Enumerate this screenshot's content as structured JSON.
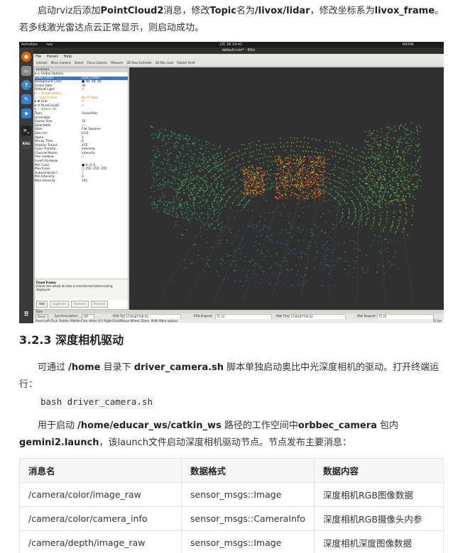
{
  "intro": {
    "t1": "启动rviz后添加",
    "b1": "PointCloud2",
    "t2": "消息，修改",
    "b2": "Topic",
    "t3": "名为",
    "b3": "/livox/lidar",
    "t4": "，修改坐标系为",
    "b4": "livox_frame",
    "t5": "。若多线激光雷达点云正常显示，则启动成功。"
  },
  "screenshot": {
    "topbar": {
      "activities": "Activities",
      "app": "rviz",
      "date": "2月 18 19:42",
      "user": "RAXIN"
    },
    "window_title": "default.rviz* - RViz",
    "menu": [
      "File",
      "Panels",
      "Help"
    ],
    "toolbar": [
      "Interact",
      "Move Camera",
      "Select",
      "Focus Camera",
      "Measure",
      "2D Pose Estimate",
      "2D Nav Goal",
      "Publish Point"
    ],
    "dock_icons": [
      {
        "name": "firefox-icon",
        "color": "#e66000",
        "glyph": "●"
      },
      {
        "name": "files-icon",
        "color": "#8a8a8a",
        "glyph": "▭"
      },
      {
        "name": "help-icon",
        "color": "#3d85c6",
        "glyph": "?"
      },
      {
        "name": "editor-icon",
        "color": "#3d7cc9",
        "glyph": "✎"
      },
      {
        "name": "vscode-icon",
        "color": "#2a7fd4",
        "glyph": "◆"
      },
      {
        "name": "terminal-icon",
        "color": "#222222",
        "glyph": ">_"
      },
      {
        "name": "rviz-icon",
        "color": "#444444",
        "glyph": "RViz"
      }
    ],
    "displays_title": "Displays",
    "properties": [
      {
        "k": "▾ ◎ Global Options",
        "v": "",
        "cls": ""
      },
      {
        "k": "      Fixed Frame",
        "v": "livox_frame",
        "cls": "sel"
      },
      {
        "k": "      Background Color",
        "v": "■ 48; 48; 48",
        "cls": ""
      },
      {
        "k": "      Frame Rate",
        "v": "30",
        "cls": ""
      },
      {
        "k": "      Default Light",
        "v": "✓",
        "cls": ""
      },
      {
        "k": "▾ ⚠ Global Status: ...",
        "v": "",
        "cls": "err"
      },
      {
        "k": "      ⚠ Fixed Frame",
        "v": "No TF data",
        "cls": "err"
      },
      {
        "k": "  ▸ ⊞ Grid",
        "v": "✓",
        "cls": ""
      },
      {
        "k": "▾ ⊡ PointCloud2",
        "v": "✓",
        "cls": ""
      },
      {
        "k": "  ▸ ✓ Status: Ok",
        "v": "",
        "cls": "grn"
      },
      {
        "k": "      Topic",
        "v": "/livox/lidar",
        "cls": ""
      },
      {
        "k": "      Unreliable",
        "v": "",
        "cls": ""
      },
      {
        "k": "      Queue Size",
        "v": "10",
        "cls": ""
      },
      {
        "k": "      Selectable",
        "v": "✓",
        "cls": ""
      },
      {
        "k": "      Style",
        "v": "Flat Squares",
        "cls": ""
      },
      {
        "k": "      Size (m)",
        "v": "0.01",
        "cls": ""
      },
      {
        "k": "      Alpha",
        "v": "1",
        "cls": ""
      },
      {
        "k": "      Decay Time",
        "v": "0",
        "cls": ""
      },
      {
        "k": "      Position Transf...",
        "v": "XYZ",
        "cls": ""
      },
      {
        "k": "      Color Transfor...",
        "v": "Intensity",
        "cls": ""
      },
      {
        "k": "      Channel Name",
        "v": "intensity",
        "cls": ""
      },
      {
        "k": "      Use rainbow",
        "v": "✓",
        "cls": ""
      },
      {
        "k": "      Invert Rainbow",
        "v": "",
        "cls": ""
      },
      {
        "k": "      Min Color",
        "v": "■ 0; 0; 0",
        "cls": ""
      },
      {
        "k": "      Max Color",
        "v": "□ 255; 255; 255",
        "cls": ""
      },
      {
        "k": "      Autocompute I...",
        "v": "✓",
        "cls": ""
      },
      {
        "k": "      Min Intensity",
        "v": "0",
        "cls": ""
      },
      {
        "k": "      Max Intensity",
        "v": "162",
        "cls": ""
      }
    ],
    "desc_title": "Fixed Frame",
    "desc_text": "Frame into which all data is transformed before being displayed.",
    "desc_buttons": [
      "Add",
      "Duplicate",
      "Remove",
      "Rename"
    ],
    "time_title": "Time",
    "time": {
      "pause": "Pause",
      "sync_label": "Synchronization:",
      "sync_value": "Off",
      "ros_time_label": "ROS Time:",
      "ros_time": "1739187729.59",
      "ros_elapsed_label": "ROS Elapsed:",
      "ros_elapsed": "71.31",
      "wall_time_label": "Wall Time:",
      "wall_time": "1739187729.62",
      "wall_elapsed_label": "Wall Elapsed:",
      "wall_elapsed": "71.25"
    },
    "status_text": "Reset  Left-Click: Rotate. Middle-Click: Move X/Y. Right-Click/Mouse Wheel: Zoom. Shift: More options.",
    "fps": "31 fps"
  },
  "section_heading": "3.2.3 深度相机驱动",
  "para2": {
    "t1": "可通过 ",
    "b1": "/home",
    "t2": " 目录下 ",
    "b2": "driver_camera.sh",
    "t3": " 脚本单独启动奥比中光深度相机的驱动。打开终端运行："
  },
  "code_line": "bash driver_camera.sh",
  "para3": {
    "t1": "用于启动 ",
    "b1": "/home/educar_ws/catkin_ws",
    "t2": " 路径的工作空间中",
    "b2": "orbbec_camera",
    "t3": " 包内",
    "b3": "gemini2.launch",
    "t4": "，该launch文件启动深度相机驱动节点。节点发布主要消息："
  },
  "table": {
    "headers": [
      "消息名",
      "数据格式",
      "数据内容"
    ],
    "rows": [
      [
        "/camera/color/image_raw",
        "sensor_msgs::Image",
        "深度相机RGB图像数据"
      ],
      [
        "/camera/color/camera_info",
        "sensor_msgs::CameraInfo",
        "深度相机RGB摄像头内参"
      ],
      [
        "/camera/depth/image_raw",
        "sensor_msgs::Image",
        "深度相机深度图像数据"
      ]
    ]
  }
}
